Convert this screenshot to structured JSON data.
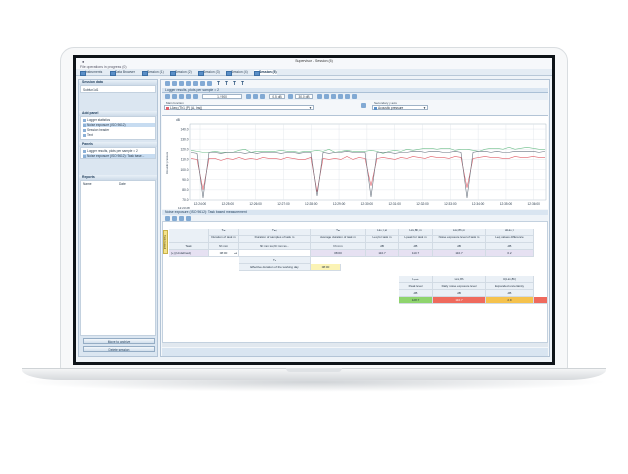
{
  "window": {
    "app_icon": "●",
    "title": "Supervisor - Session (5)",
    "status": "File operations in progress (0)"
  },
  "tabs": [
    {
      "label": "Instruments"
    },
    {
      "label": "Data Browser"
    },
    {
      "label": "Session (1)"
    },
    {
      "label": "Session (2)"
    },
    {
      "label": "Session (3)"
    },
    {
      "label": "Session (4)"
    },
    {
      "label": "Session (5)"
    }
  ],
  "sidebar": {
    "session_data": {
      "title": "Session data",
      "item": "Subfun1d1"
    },
    "add_panel": {
      "title": "Add panel",
      "items": [
        {
          "label": "Logger statistics"
        },
        {
          "label": "Noise exposure (ISO 9612)"
        },
        {
          "label": "Session header"
        },
        {
          "label": "Text"
        }
      ]
    },
    "panels": {
      "title": "Panels",
      "items": [
        {
          "label": "Logger results, plots per sample = 2"
        },
        {
          "label": "Noise exposure (ISO 9612): Task base..."
        }
      ]
    },
    "reports": {
      "title": "Reports",
      "col_name": "Name",
      "col_date": "Date"
    },
    "buttons": {
      "archive": "Move to archive",
      "delete": "Delete session"
    }
  },
  "chart_panel": {
    "header": "Logger results, plots per sample = 2",
    "page_value": "1 / 900",
    "zoom_a": "0.5 dB",
    "zoom_b": "30.0 dB",
    "main_function_label": "Main function",
    "main_function_value": "LAeq (Th1 (P) (A, Ins))",
    "secondary_label": "Secondary y axis",
    "secondary_value": "Acoustic pressure",
    "y_unit": "dB",
    "y_axis_title": "Acoustic pressure"
  },
  "chart_data": {
    "type": "line",
    "ylabel": "Acoustic pressure",
    "y_unit": "dB",
    "ylim": [
      70.0,
      145.0
    ],
    "y_ticks": [
      "140.0",
      "130.0",
      "120.0",
      "110.0",
      "100.0",
      "90.0",
      "80.0",
      "70.0"
    ],
    "x_ticks": [
      "12:24:00",
      "12:25:00",
      "12:26:00",
      "12:27:00",
      "12:28:00",
      "12:29:00",
      "12:30:00",
      "12:31:00",
      "12:32:00",
      "12:33:00",
      "12:34:00",
      "12:35:00",
      "12:36:00"
    ],
    "x_start_label": "12:23:28",
    "grid": true,
    "series": [
      {
        "color": "#6fbf8b",
        "values": [
          119,
          118,
          117,
          117,
          118,
          117,
          117,
          117,
          119,
          120,
          117,
          118,
          118,
          118,
          118,
          119,
          118,
          118,
          117,
          118,
          118,
          119,
          118,
          120,
          117,
          118,
          119,
          118,
          118,
          118,
          119,
          118,
          116,
          118,
          119,
          118,
          120,
          119,
          120,
          121,
          121,
          120,
          121,
          121,
          119,
          120,
          120,
          119,
          118,
          120,
          121,
          121,
          120,
          122,
          120,
          121,
          122,
          121,
          120,
          120
        ]
      },
      {
        "color": "#e0606a",
        "values": [
          111,
          110,
          80,
          111,
          111,
          109,
          111,
          110,
          112,
          110,
          111,
          110,
          112,
          111,
          111,
          110,
          112,
          111,
          110,
          110,
          112,
          78,
          111,
          110,
          111,
          110,
          113,
          110,
          112,
          111,
          84,
          111,
          112,
          111,
          110,
          112,
          111,
          113,
          112,
          111,
          113,
          112,
          112,
          111,
          113,
          112,
          82,
          111,
          112,
          113,
          112,
          112,
          111,
          111,
          113,
          112,
          112,
          113,
          112,
          112
        ]
      },
      {
        "color": "#6a7480",
        "values": [
          117,
          116,
          72,
          117,
          117,
          116,
          117,
          117,
          117,
          116,
          117,
          116,
          117,
          117,
          117,
          116,
          117,
          117,
          116,
          117,
          117,
          74,
          117,
          116,
          117,
          117,
          118,
          117,
          117,
          117,
          73,
          117,
          117,
          117,
          116,
          117,
          117,
          118,
          118,
          117,
          118,
          118,
          117,
          117,
          118,
          117,
          72,
          117,
          118,
          118,
          117,
          118,
          117,
          117,
          118,
          118,
          118,
          118,
          117,
          118
        ]
      }
    ]
  },
  "noise_panel": {
    "header": "Noise exposure (ISO 9612): Task based measurement",
    "vertical_tab": "Task based",
    "row_header_task": "Task",
    "task_name": "[+] {Undefined}",
    "columns": [
      {
        "symbol": "Tₘ",
        "label": "Duration of task m",
        "unit": "hh:mm"
      },
      {
        "symbol": "Tₘ,ᵢ",
        "label": "Duration of samples of task m",
        "unit": "hh:mm:ss,hh:mm:ss..."
      },
      {
        "symbol": "T̅ₘ",
        "label": "Average duration of task m",
        "unit": "hh:mm"
      },
      {
        "symbol": "Lᴇᴀ,ᴛ,ᴍ",
        "label": "Leq for task m",
        "unit": "dB"
      },
      {
        "symbol": "Lᴇx,8h,m",
        "label": "Lpeak for task m",
        "unit": "dB"
      },
      {
        "symbol": "Lᴇx,8h,m",
        "label": "Noise exposure level of task m",
        "unit": "dB"
      },
      {
        "symbol": "ΔLᴇᴀ,ᴛ",
        "label": "Leq values difference",
        "unit": "dB"
      }
    ],
    "row_values": [
      "08:00",
      "",
      "08:00",
      "110.7",
      "110.7",
      "110.7",
      "0.2"
    ],
    "effective": {
      "symbol": "Tₑ",
      "label": "Effective duration of the working day",
      "value": "08:00"
    },
    "summary": [
      {
        "symbol": "Lₚₑₐₖ",
        "label": "Peak level",
        "unit": "dB",
        "value": "128.7",
        "color": "#8fd46d"
      },
      {
        "symbol": "Lᴇx,8h",
        "label": "Daily noise exposure level",
        "unit": "dB",
        "value": "110.7",
        "color": "#ef6a5d"
      },
      {
        "symbol": "U(Lᴇx,8h)",
        "label": "Expanded uncertainty",
        "unit": "dB",
        "value": "2.9",
        "color": "#f5c24d"
      }
    ]
  }
}
